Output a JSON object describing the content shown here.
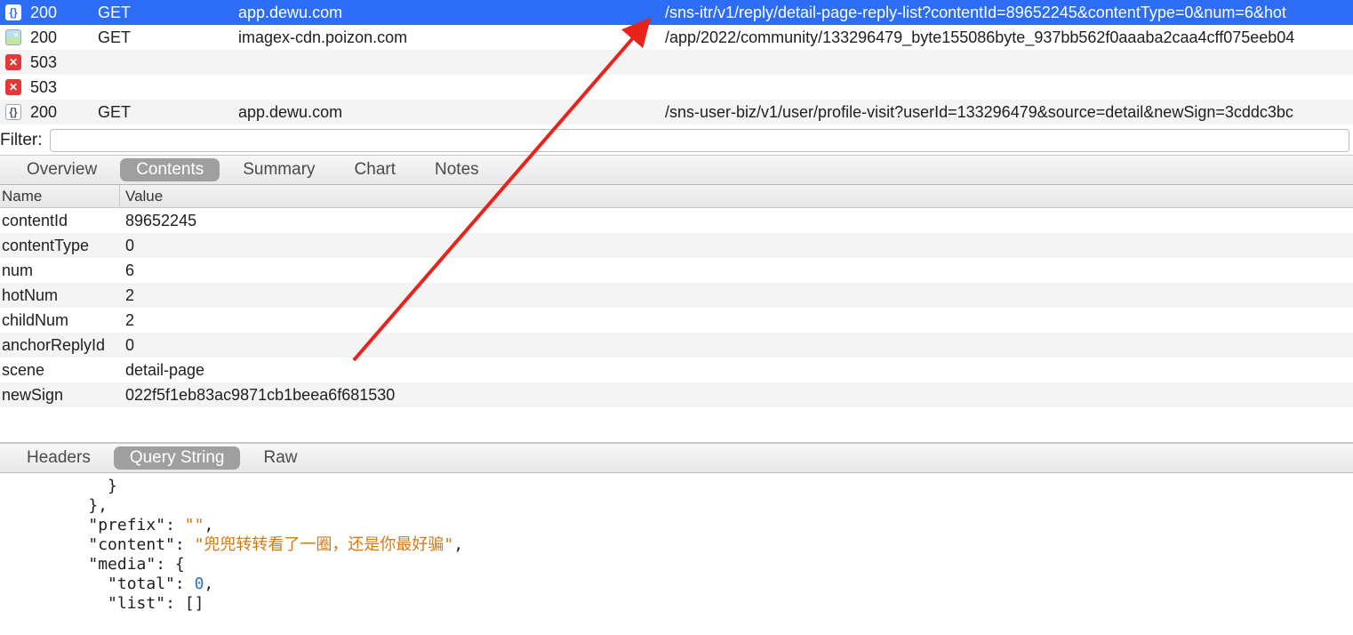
{
  "requests": [
    {
      "icon": "json-sel",
      "code": "200",
      "method": "GET",
      "host": "app.dewu.com",
      "path": "/sns-itr/v1/reply/detail-page-reply-list?contentId=89652245&contentType=0&num=6&hot",
      "selected": true
    },
    {
      "icon": "img",
      "code": "200",
      "method": "GET",
      "host": "imagex-cdn.poizon.com",
      "path": "/app/2022/community/133296479_byte155086byte_937bb562f0aaaba2caa4cff075eeb04",
      "selected": false
    },
    {
      "icon": "err",
      "code": "503",
      "method": "",
      "host": "",
      "path": "",
      "selected": false
    },
    {
      "icon": "err",
      "code": "503",
      "method": "",
      "host": "",
      "path": "",
      "selected": false
    },
    {
      "icon": "json",
      "code": "200",
      "method": "GET",
      "host": "app.dewu.com",
      "path": "/sns-user-biz/v1/user/profile-visit?userId=133296479&source=detail&newSign=3cddc3bc",
      "selected": false
    }
  ],
  "filter": {
    "label": "Filter:",
    "value": ""
  },
  "tabs_upper": {
    "items": [
      "Overview",
      "Contents",
      "Summary",
      "Chart",
      "Notes"
    ],
    "active": 1
  },
  "kv": {
    "headers": {
      "name": "Name",
      "value": "Value"
    },
    "rows": [
      {
        "name": "contentId",
        "value": "89652245"
      },
      {
        "name": "contentType",
        "value": "0"
      },
      {
        "name": "num",
        "value": "6"
      },
      {
        "name": "hotNum",
        "value": "2"
      },
      {
        "name": "childNum",
        "value": "2"
      },
      {
        "name": "anchorReplyId",
        "value": "0"
      },
      {
        "name": "scene",
        "value": "detail-page"
      },
      {
        "name": "newSign",
        "value": "022f5f1eb83ac9871cb1beea6f681530"
      }
    ]
  },
  "tabs_lower": {
    "items": [
      "Headers",
      "Query String",
      "Raw"
    ],
    "active": 1
  },
  "json_body": {
    "l1": "      }",
    "l2": "    },",
    "k_prefix": "\"prefix\"",
    "v_prefix": "\"\"",
    "k_content": "\"content\"",
    "v_content": "\"兜兜转转看了一圈，还是你最好骗\"",
    "k_media": "\"media\"",
    "k_total": "\"total\"",
    "v_total": "0",
    "k_list": "\"list\"",
    "v_list": "[]"
  },
  "icon_glyph": {
    "json": "{}",
    "err": "✕"
  }
}
